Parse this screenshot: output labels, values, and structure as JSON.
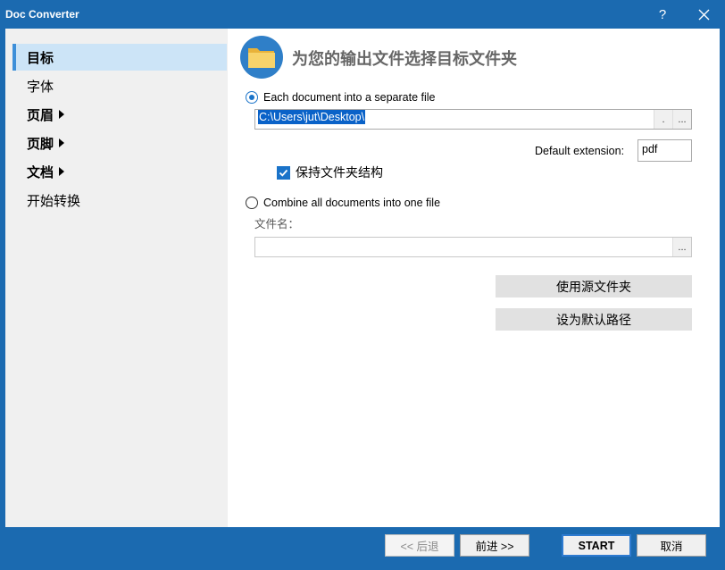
{
  "window": {
    "title": "Doc Converter",
    "help_label": "?"
  },
  "sidebar": {
    "items": [
      {
        "label": "目标",
        "selected": true,
        "bold": true,
        "has_arrow": false
      },
      {
        "label": "字体",
        "selected": false,
        "bold": false,
        "has_arrow": false
      },
      {
        "label": "页眉",
        "selected": false,
        "bold": true,
        "has_arrow": true
      },
      {
        "label": "页脚",
        "selected": false,
        "bold": true,
        "has_arrow": true
      },
      {
        "label": "文档",
        "selected": false,
        "bold": true,
        "has_arrow": true
      },
      {
        "label": "开始转换",
        "selected": false,
        "bold": false,
        "has_arrow": false
      }
    ]
  },
  "main": {
    "header_title": "为您的输出文件选择目标文件夹",
    "option_separate": {
      "label": "Each document into a separate file",
      "checked": true
    },
    "output_path": "C:\\Users\\jut\\Desktop\\",
    "dot_button_label": ".",
    "browse_label": "...",
    "default_extension_label": "Default extension:",
    "default_extension_value": "pdf",
    "keep_structure_label": "保持文件夹结构",
    "keep_structure_checked": true,
    "option_combine": {
      "label": "Combine all documents into one file",
      "checked": false
    },
    "filename_label": "文件名：",
    "filename_value": "",
    "filename_browse_label": "...",
    "use_source_folder_label": "使用源文件夹",
    "set_default_path_label": "设为默认路径"
  },
  "footer": {
    "back_label": "<< 后退",
    "next_label": "前进 >>",
    "start_label": "START",
    "cancel_label": "取消"
  },
  "colors": {
    "accent": "#1b6ab0",
    "selection": "#cce4f7",
    "radio_check": "#1a73c9"
  }
}
